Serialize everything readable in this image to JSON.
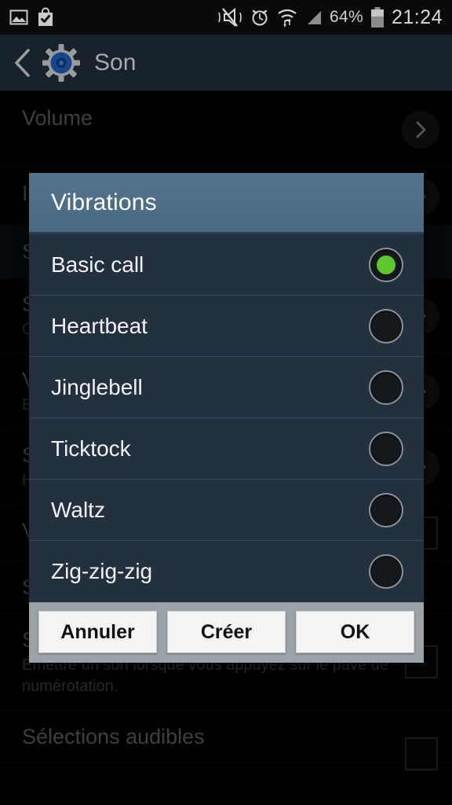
{
  "status_bar": {
    "left_icons": [
      {
        "name": "screenshot-image-icon"
      },
      {
        "name": "play-store-bag-check-icon"
      }
    ],
    "right_icons": [
      {
        "name": "vibrate-mute-icon"
      },
      {
        "name": "alarm-clock-icon"
      },
      {
        "name": "wifi-data-transfer-icon"
      },
      {
        "name": "cellular-signal-icon"
      }
    ],
    "battery_percent": "64%",
    "clock": "21:24"
  },
  "action_bar": {
    "back_icon": "back-chevron-icon",
    "app_icon": "settings-gear-icon",
    "title": "Son"
  },
  "background_list": [
    {
      "title": "Volume",
      "sub": "",
      "accessory": "chevron"
    },
    {
      "title": "I",
      "sub": "",
      "accessory": "chevron"
    },
    {
      "title": "S",
      "sub": "",
      "accessory": "none",
      "highlight": true
    },
    {
      "title": "S",
      "sub": "O",
      "accessory": "chevron"
    },
    {
      "title": "V",
      "sub": "B",
      "accessory": "chevron"
    },
    {
      "title": "S",
      "sub": "H",
      "accessory": "chevron"
    },
    {
      "title": "V",
      "sub": "",
      "accessory": "checkbox"
    },
    {
      "title": "S",
      "sub": "",
      "accessory": "none"
    },
    {
      "title": "Son pavé de numérotation",
      "sub": "Émettre un son lorsque vous appuyez sur le pavé de numérotation.",
      "accessory": "checkbox"
    },
    {
      "title": "Sélections audibles",
      "sub": "",
      "accessory": "checkbox"
    }
  ],
  "dialog": {
    "title": "Vibrations",
    "options": [
      {
        "label": "Basic call",
        "selected": true
      },
      {
        "label": "Heartbeat",
        "selected": false
      },
      {
        "label": "Jinglebell",
        "selected": false
      },
      {
        "label": "Ticktock",
        "selected": false
      },
      {
        "label": "Waltz",
        "selected": false
      },
      {
        "label": "Zig-zig-zig",
        "selected": false
      }
    ],
    "buttons": [
      {
        "label": "Annuler",
        "name": "cancel-button"
      },
      {
        "label": "Créer",
        "name": "create-button"
      },
      {
        "label": "OK",
        "name": "ok-button"
      }
    ]
  },
  "colors": {
    "dialog_header": "#4a6b84",
    "dialog_body": "#223040",
    "radio_selected": "#5ec92e",
    "button_bar": "#9ba2a8",
    "action_bar": "#18222c"
  }
}
